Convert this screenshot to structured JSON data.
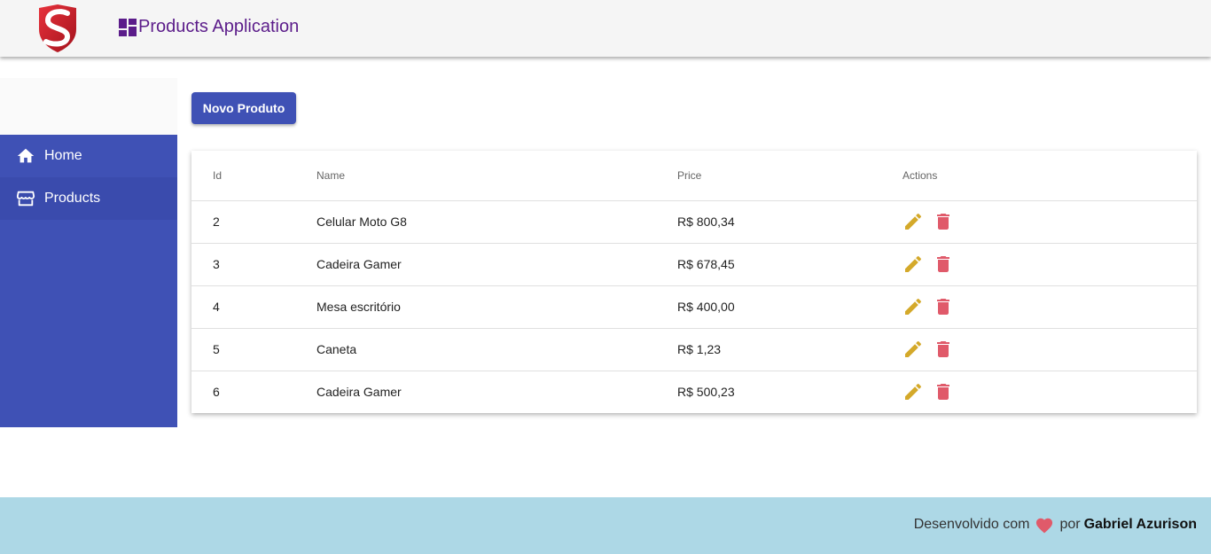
{
  "header": {
    "title": "Products Application",
    "logo_icon": "shield-s-logo",
    "title_icon": "dashboard-icon"
  },
  "sidebar": {
    "items": [
      {
        "label": "Home",
        "icon": "home-icon"
      },
      {
        "label": "Products",
        "icon": "store-icon"
      }
    ]
  },
  "toolbar": {
    "new_product_label": "Novo Produto"
  },
  "table": {
    "columns": [
      "Id",
      "Name",
      "Price",
      "Actions"
    ],
    "rows": [
      {
        "id": "2",
        "name": "Celular Moto G8",
        "price": "R$ 800,34"
      },
      {
        "id": "3",
        "name": "Cadeira Gamer",
        "price": "R$ 678,45"
      },
      {
        "id": "4",
        "name": "Mesa escritório",
        "price": "R$ 400,00"
      },
      {
        "id": "5",
        "name": "Caneta",
        "price": "R$ 1,23"
      },
      {
        "id": "6",
        "name": "Cadeira Gamer",
        "price": "R$ 500,23"
      }
    ],
    "action_icons": [
      "edit-icon",
      "delete-icon"
    ]
  },
  "footer": {
    "prefix": "Desenvolvido com",
    "middle": "por",
    "author": "Gabriel Azurison"
  },
  "colors": {
    "primary": "#3f51b5",
    "title": "#5b1c8a",
    "edit": "#d4a92a",
    "delete": "#e05a6a",
    "footer_bg": "#add8e6",
    "heart": "#e05a6a"
  }
}
